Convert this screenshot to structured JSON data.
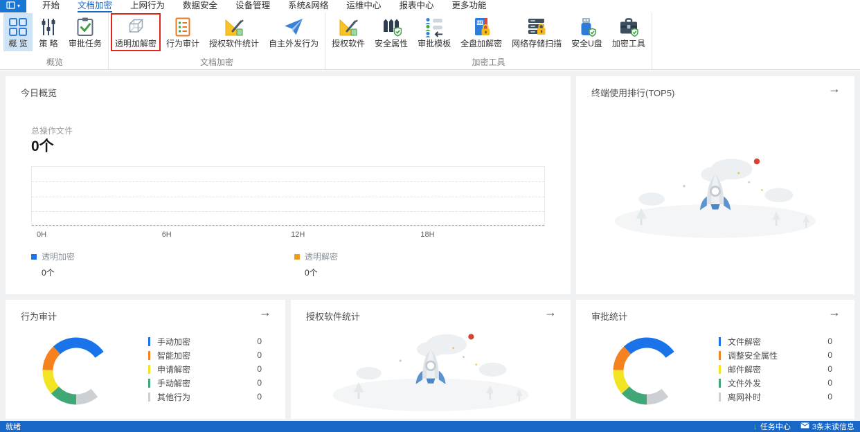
{
  "menubar": {
    "app_button": {
      "caret": "▾"
    },
    "tabs": [
      {
        "id": "home",
        "label": "开始",
        "active": false
      },
      {
        "id": "doc-encryption",
        "label": "文档加密",
        "active": true
      },
      {
        "id": "web-behavior",
        "label": "上网行为",
        "active": false
      },
      {
        "id": "data-security",
        "label": "数据安全",
        "active": false
      },
      {
        "id": "device-management",
        "label": "设备管理",
        "active": false
      },
      {
        "id": "system-network",
        "label": "系统&网络",
        "active": false
      },
      {
        "id": "ops-center",
        "label": "运维中心",
        "active": false
      },
      {
        "id": "report-center",
        "label": "报表中心",
        "active": false
      },
      {
        "id": "more-features",
        "label": "更多功能",
        "active": false
      }
    ]
  },
  "ribbon": {
    "annotation_color": "#e0261c",
    "groups": [
      {
        "label": "概览",
        "items": [
          {
            "id": "overview",
            "label": "概 览",
            "icon": "grid-icon",
            "selected": true
          },
          {
            "id": "policy",
            "label": "策 略",
            "icon": "sliders-icon"
          },
          {
            "id": "approval-tasks",
            "label": "审批任务",
            "icon": "clipboard-check-icon"
          }
        ]
      },
      {
        "label": "文档加密",
        "items": [
          {
            "id": "transparent-encryption",
            "label": "透明加解密",
            "icon": "cube-icon",
            "annotated": true
          },
          {
            "id": "behavior-audit",
            "label": "行为审计",
            "icon": "audit-list-icon"
          },
          {
            "id": "licensed-software-stats",
            "label": "授权软件统计",
            "icon": "ruler-pencil-icon"
          },
          {
            "id": "self-outgoing-behavior",
            "label": "自主外发行为",
            "icon": "paper-plane-icon"
          }
        ]
      },
      {
        "label": "加密工具",
        "items": [
          {
            "id": "licensed-software",
            "label": "授权软件",
            "icon": "ruler-pencil-icon"
          },
          {
            "id": "security-attribute",
            "label": "安全属性",
            "icon": "fence-shield-icon"
          },
          {
            "id": "approval-template",
            "label": "审批模板",
            "icon": "approval-template-icon"
          },
          {
            "id": "full-disk-encryption",
            "label": "全盘加解密",
            "icon": "ssd-lock-icon"
          },
          {
            "id": "network-storage-scan",
            "label": "网络存储扫描",
            "icon": "server-lock-icon"
          },
          {
            "id": "secure-usb",
            "label": "安全U盘",
            "icon": "usb-shield-icon"
          },
          {
            "id": "encryption-tools",
            "label": "加密工具",
            "icon": "toolbox-shield-icon"
          }
        ]
      }
    ]
  },
  "cards": {
    "today": {
      "title": "今日概览",
      "metric_label": "总操作文件",
      "metric_value": "0个",
      "x_ticks": [
        "0H",
        "6H",
        "12H",
        "18H"
      ],
      "legend": [
        {
          "label": "透明加密",
          "value": "0个",
          "color": "#1a73e8"
        },
        {
          "label": "透明解密",
          "value": "0个",
          "color": "#f09a1e"
        }
      ]
    },
    "terminal_rank": {
      "title": "终端使用排行(TOP5)",
      "arrow": "→"
    },
    "behavior_audit": {
      "title": "行为审计",
      "arrow": "→",
      "legend": [
        {
          "label": "手动加密",
          "value": "0",
          "color": "#1a73e8"
        },
        {
          "label": "智能加密",
          "value": "0",
          "color": "#f5821f"
        },
        {
          "label": "申请解密",
          "value": "0",
          "color": "#f2e422"
        },
        {
          "label": "手动解密",
          "value": "0",
          "color": "#3fa876"
        },
        {
          "label": "其他行为",
          "value": "0",
          "color": "#ccd0d3"
        }
      ]
    },
    "software_stats": {
      "title": "授权软件统计",
      "arrow": "→"
    },
    "approval_stats": {
      "title": "审批统计",
      "arrow": "→",
      "legend": [
        {
          "label": "文件解密",
          "value": "0",
          "color": "#1a73e8"
        },
        {
          "label": "调整安全属性",
          "value": "0",
          "color": "#f5821f"
        },
        {
          "label": "邮件解密",
          "value": "0",
          "color": "#f2e422"
        },
        {
          "label": "文件外发",
          "value": "0",
          "color": "#3fa876"
        },
        {
          "label": "离网补时",
          "value": "0",
          "color": "#ccd0d3"
        }
      ]
    }
  },
  "donut_segments": [
    {
      "color": "#1a73e8",
      "from": 317,
      "to": 415
    },
    {
      "color": "#f5821f",
      "from": 272,
      "to": 317
    },
    {
      "color": "#f2e422",
      "from": 228,
      "to": 272
    },
    {
      "color": "#3fa876",
      "from": 180,
      "to": 228
    },
    {
      "color": "#ccd0d3",
      "from": 140,
      "to": 180
    }
  ],
  "chart_data": [
    {
      "type": "line",
      "title": "今日概览",
      "x_ticks": [
        "0H",
        "6H",
        "12H",
        "18H"
      ],
      "x_range": [
        "0H",
        "24H"
      ],
      "grid": true,
      "series": [
        {
          "name": "透明加密",
          "color": "#1a73e8",
          "total": "0个",
          "values": []
        },
        {
          "name": "透明解密",
          "color": "#f09a1e",
          "total": "0个",
          "values": []
        }
      ]
    },
    {
      "type": "pie",
      "title": "行为审计",
      "labels": [
        "手动加密",
        "智能加密",
        "申请解密",
        "手动解密",
        "其他行为"
      ],
      "values": [
        0,
        0,
        0,
        0,
        0
      ],
      "colors": [
        "#1a73e8",
        "#f5821f",
        "#f2e422",
        "#3fa876",
        "#ccd0d3"
      ],
      "legend_position": "right"
    },
    {
      "type": "pie",
      "title": "审批统计",
      "labels": [
        "文件解密",
        "调整安全属性",
        "邮件解密",
        "文件外发",
        "离网补时"
      ],
      "values": [
        0,
        0,
        0,
        0,
        0
      ],
      "colors": [
        "#1a73e8",
        "#f5821f",
        "#f2e422",
        "#3fa876",
        "#ccd0d3"
      ],
      "legend_position": "right"
    }
  ],
  "statusbar": {
    "ready": "就绪",
    "task_icon": "↓",
    "task_center": "任务中心",
    "unread": "3条未读信息",
    "bar_color": "#1866c5"
  }
}
